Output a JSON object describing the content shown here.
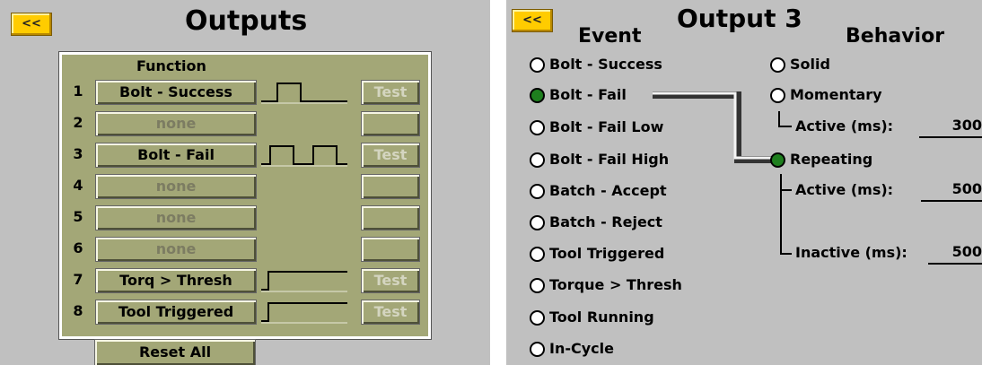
{
  "outputs_screen": {
    "back_label": "<<",
    "title": "Outputs",
    "function_header": "Function",
    "rows": [
      {
        "num": "1",
        "function": "Bolt - Success",
        "test": "Test"
      },
      {
        "num": "2",
        "function": "none",
        "test": ""
      },
      {
        "num": "3",
        "function": "Bolt - Fail",
        "test": "Test"
      },
      {
        "num": "4",
        "function": "none",
        "test": ""
      },
      {
        "num": "5",
        "function": "none",
        "test": ""
      },
      {
        "num": "6",
        "function": "none",
        "test": ""
      },
      {
        "num": "7",
        "function": "Torq > Thresh",
        "test": "Test"
      },
      {
        "num": "8",
        "function": "Tool Triggered",
        "test": "Test"
      }
    ],
    "reset_label": "Reset All"
  },
  "output_detail": {
    "back_label": "<<",
    "title": "Output 3",
    "event_header": "Event",
    "behavior_header": "Behavior",
    "events": [
      {
        "label": "Bolt - Success",
        "selected": false
      },
      {
        "label": "Bolt - Fail",
        "selected": true
      },
      {
        "label": "Bolt - Fail Low",
        "selected": false
      },
      {
        "label": "Bolt - Fail High",
        "selected": false
      },
      {
        "label": "Batch - Accept",
        "selected": false
      },
      {
        "label": "Batch - Reject",
        "selected": false
      },
      {
        "label": "Tool Triggered",
        "selected": false
      },
      {
        "label": "Torque > Thresh",
        "selected": false
      },
      {
        "label": "Tool Running",
        "selected": false
      },
      {
        "label": "In-Cycle",
        "selected": false
      }
    ],
    "behaviors": [
      {
        "label": "Solid",
        "selected": false
      },
      {
        "label": "Momentary",
        "selected": false
      },
      {
        "label": "Repeating",
        "selected": true
      }
    ],
    "momentary_active_label": "Active (ms):",
    "momentary_active_value": "300",
    "repeating_active_label": "Active (ms):",
    "repeating_active_value": "500",
    "repeating_inactive_label": "Inactive (ms):",
    "repeating_inactive_value": "500",
    "colors": {
      "selected_radio": "#1e7f1e",
      "table_bg": "#a3a777",
      "back_button": "#ffcc00"
    }
  }
}
